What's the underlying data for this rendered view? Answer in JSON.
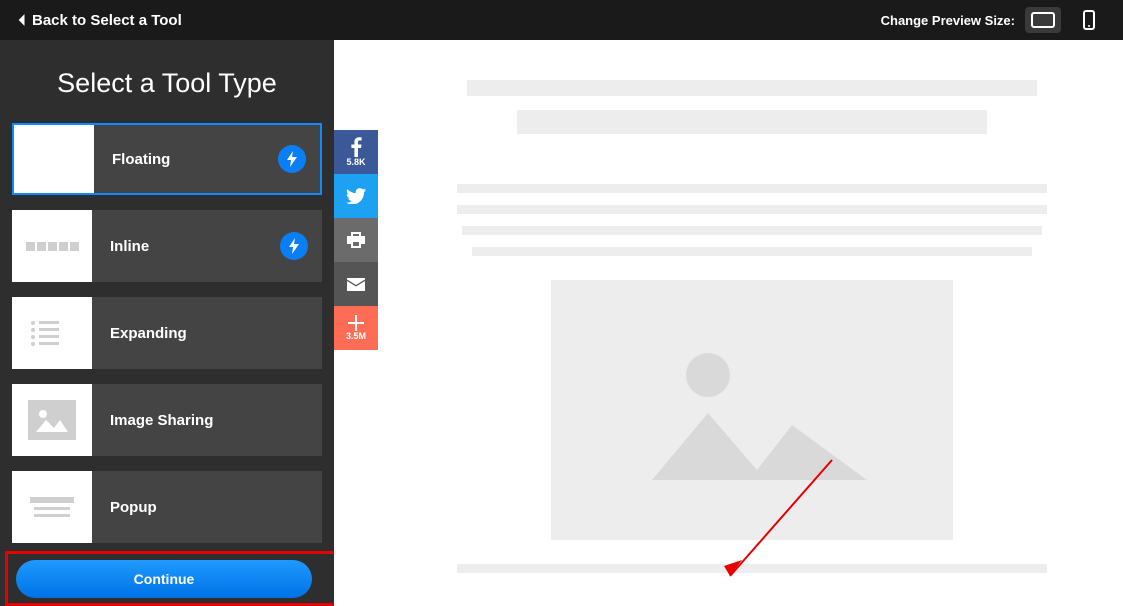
{
  "topbar": {
    "back_label": "Back to Select a Tool",
    "preview_label": "Change Preview Size:"
  },
  "sidebar": {
    "title": "Select a Tool Type",
    "tools": [
      {
        "label": "Floating"
      },
      {
        "label": "Inline"
      },
      {
        "label": "Expanding"
      },
      {
        "label": "Image Sharing"
      },
      {
        "label": "Popup"
      }
    ],
    "continue_label": "Continue"
  },
  "share_bar": {
    "facebook_count": "5.8K",
    "plus_count": "3.5M"
  }
}
